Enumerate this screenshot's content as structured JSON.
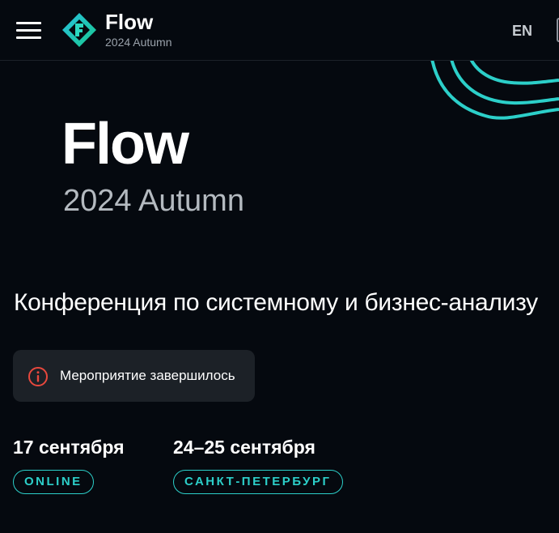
{
  "header": {
    "brand_title": "Flow",
    "brand_subtitle": "2024 Autumn",
    "language": "EN"
  },
  "hero": {
    "title": "Flow",
    "subtitle": "2024 Autumn",
    "tagline": "Конференция по системному и бизнес-анализу"
  },
  "notice": {
    "text": "Мероприятие завершилось",
    "icon": "info-icon"
  },
  "events": [
    {
      "date": "17 сентября",
      "badge": "ONLINE"
    },
    {
      "date": "24–25 сентября",
      "badge": "САНКТ-ПЕТЕРБУРГ"
    }
  ],
  "colors": {
    "background": "#05090f",
    "accent": "#2ccfc9",
    "notice_bg": "#1c2127",
    "notice_icon": "#e8483d",
    "muted_text": "#b4bac0"
  }
}
